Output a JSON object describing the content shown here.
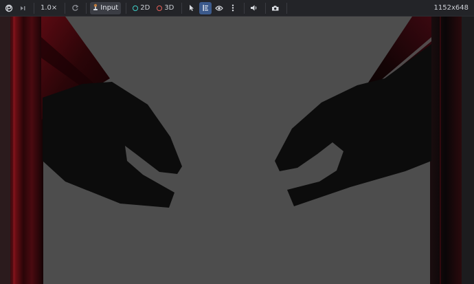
{
  "toolbar": {
    "speed_label": "1.0×",
    "input_label": "Input",
    "mode_2d_label": "2D",
    "mode_3d_label": "3D",
    "resolution_label": "1152x648"
  },
  "colors": {
    "viewport_background": "#4d4d4d",
    "toolbar_background": "#232428",
    "accent_blue": "#4a8fe7",
    "accent_2d": "#3fd0c9",
    "accent_3d": "#e8615a",
    "pillar_red": "#6e0e14"
  },
  "icons": [
    "game-logo-icon",
    "step-frame-icon",
    "reset-icon",
    "input-joystick-icon",
    "select-arrow-icon",
    "list-icon",
    "eye-icon",
    "more-vertical-icon",
    "speaker-icon",
    "camera-icon"
  ]
}
